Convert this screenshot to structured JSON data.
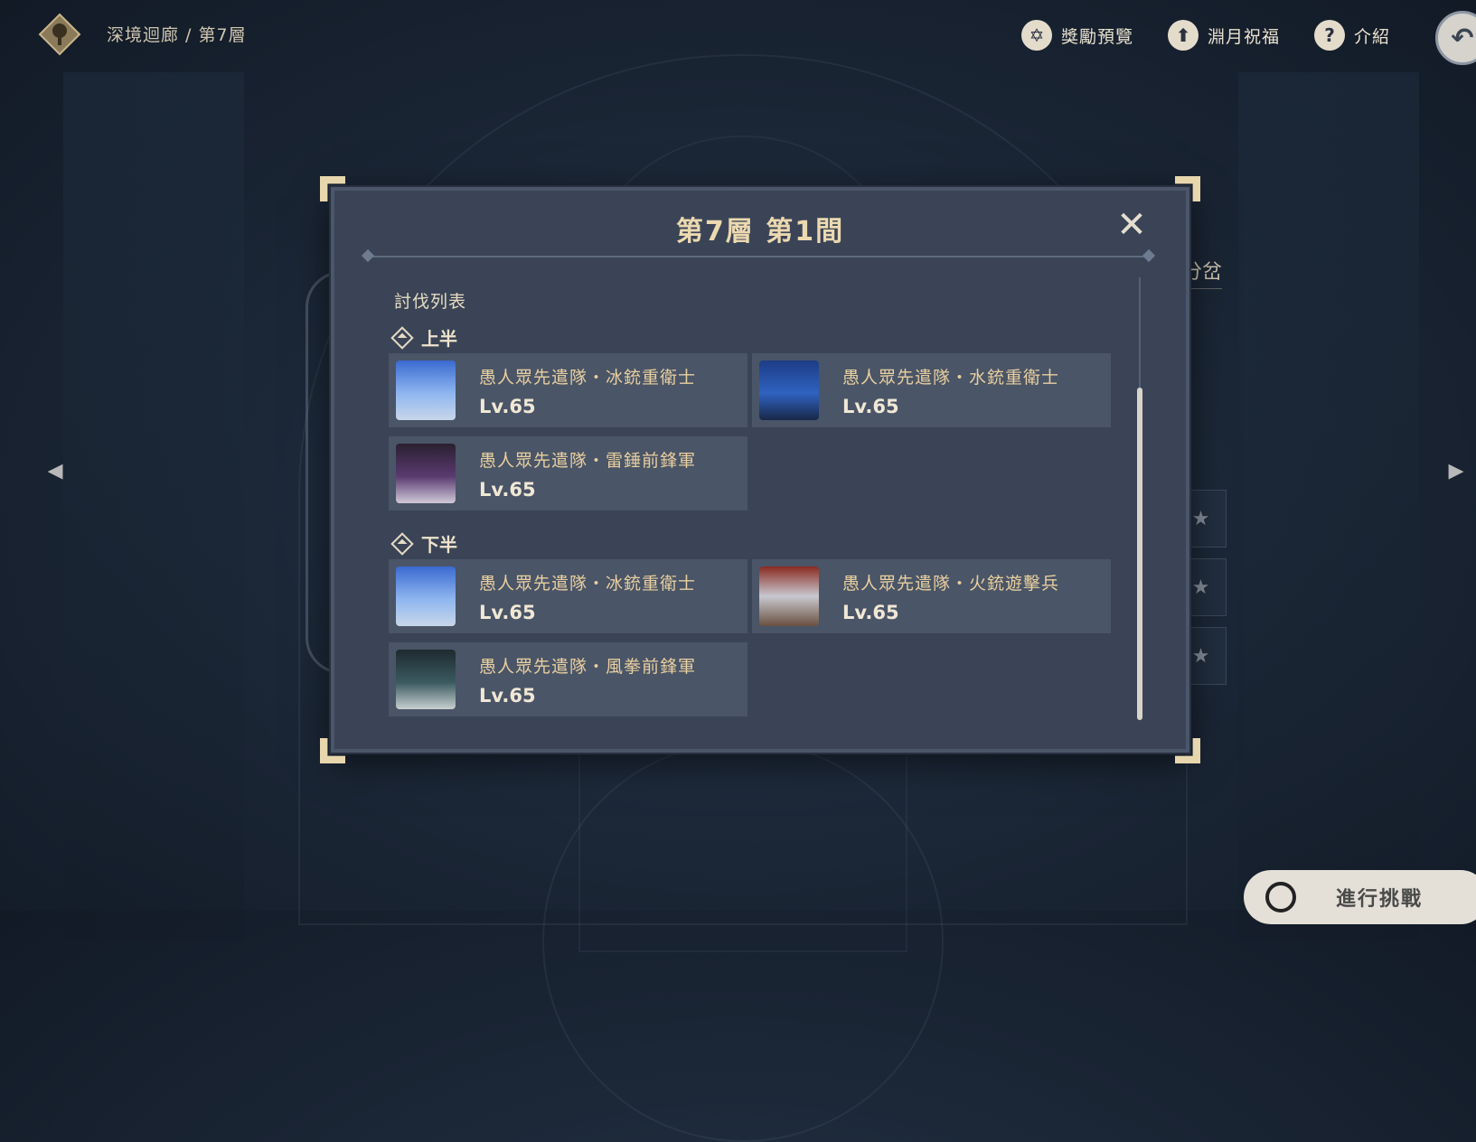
{
  "header": {
    "breadcrumb": "深境迴廊 / 第7層",
    "rewards_label": "獎勵預覽",
    "blessing_label": "淵月祝福",
    "info_label": "介紹"
  },
  "background": {
    "partial_text": "分岔",
    "dot": "。"
  },
  "modal": {
    "title": "第7層 第1間",
    "list_heading": "討伐列表",
    "first_half": {
      "label": "上半",
      "enemies": [
        {
          "name": "愚人眾先遣隊・冰銃重衛士",
          "level": "Lv.65",
          "portrait": "cryo-gunner-icon"
        },
        {
          "name": "愚人眾先遣隊・水銃重衛士",
          "level": "Lv.65",
          "portrait": "hydro-gunner-icon"
        },
        {
          "name": "愚人眾先遣隊・雷錘前鋒軍",
          "level": "Lv.65",
          "portrait": "electro-hammer-icon"
        }
      ]
    },
    "second_half": {
      "label": "下半",
      "enemies": [
        {
          "name": "愚人眾先遣隊・冰銃重衛士",
          "level": "Lv.65",
          "portrait": "cryo-gunner-icon"
        },
        {
          "name": "愚人眾先遣隊・火銃遊擊兵",
          "level": "Lv.65",
          "portrait": "pyro-skirmisher-icon"
        },
        {
          "name": "愚人眾先遣隊・風拳前鋒軍",
          "level": "Lv.65",
          "portrait": "anemo-boxer-icon"
        }
      ]
    }
  },
  "footer": {
    "challenge_label": "進行挑戰"
  },
  "colors": {
    "title": "#ecd9b0",
    "enemy_name": "#e8cf9f",
    "modal_bg": "#3a4456",
    "card_bg": "#4a5567"
  }
}
